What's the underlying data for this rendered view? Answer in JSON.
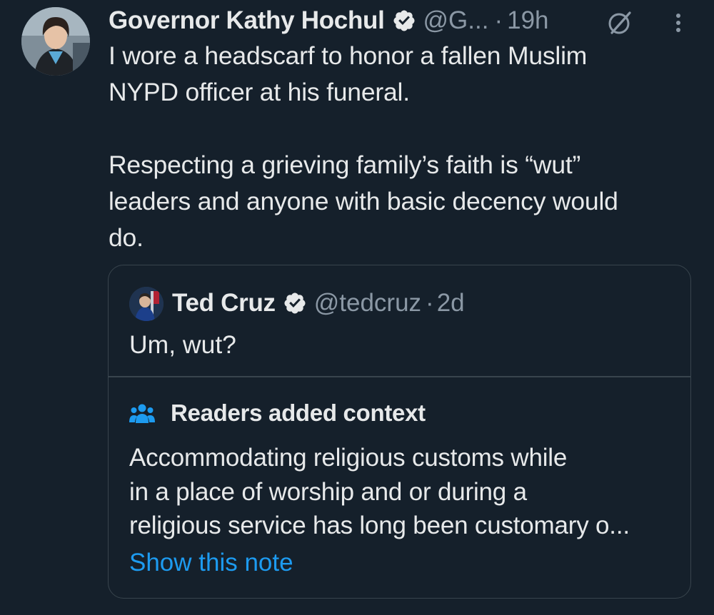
{
  "tweet": {
    "author_name": "Governor Kathy Hochul",
    "handle": "@G...",
    "separator": "·",
    "time": "19h",
    "text": "I wore a headscarf to honor a fallen Muslim\nNYPD officer at his funeral.\n\nRespecting a grieving family’s faith is “wut”\nleaders and anyone with basic decency would\ndo."
  },
  "quoted_tweet": {
    "author_name": "Ted Cruz",
    "handle": "@tedcruz",
    "separator": "·",
    "time": "2d",
    "text": "Um, wut?"
  },
  "community_note": {
    "title": "Readers added context",
    "text": "Accommodating religious customs while\nin a place of worship and or during a\nreligious service has long been customary o...",
    "link_label": "Show this note"
  },
  "icons": {
    "verified": "verified-badge-icon",
    "grok": "grok-icon",
    "more": "more-options-icon",
    "community": "community-notes-icon"
  },
  "colors": {
    "background": "#15202b",
    "text_primary": "#e7e9ea",
    "text_secondary": "#8b98a5",
    "link": "#1d9bf0",
    "border": "#38444d"
  }
}
